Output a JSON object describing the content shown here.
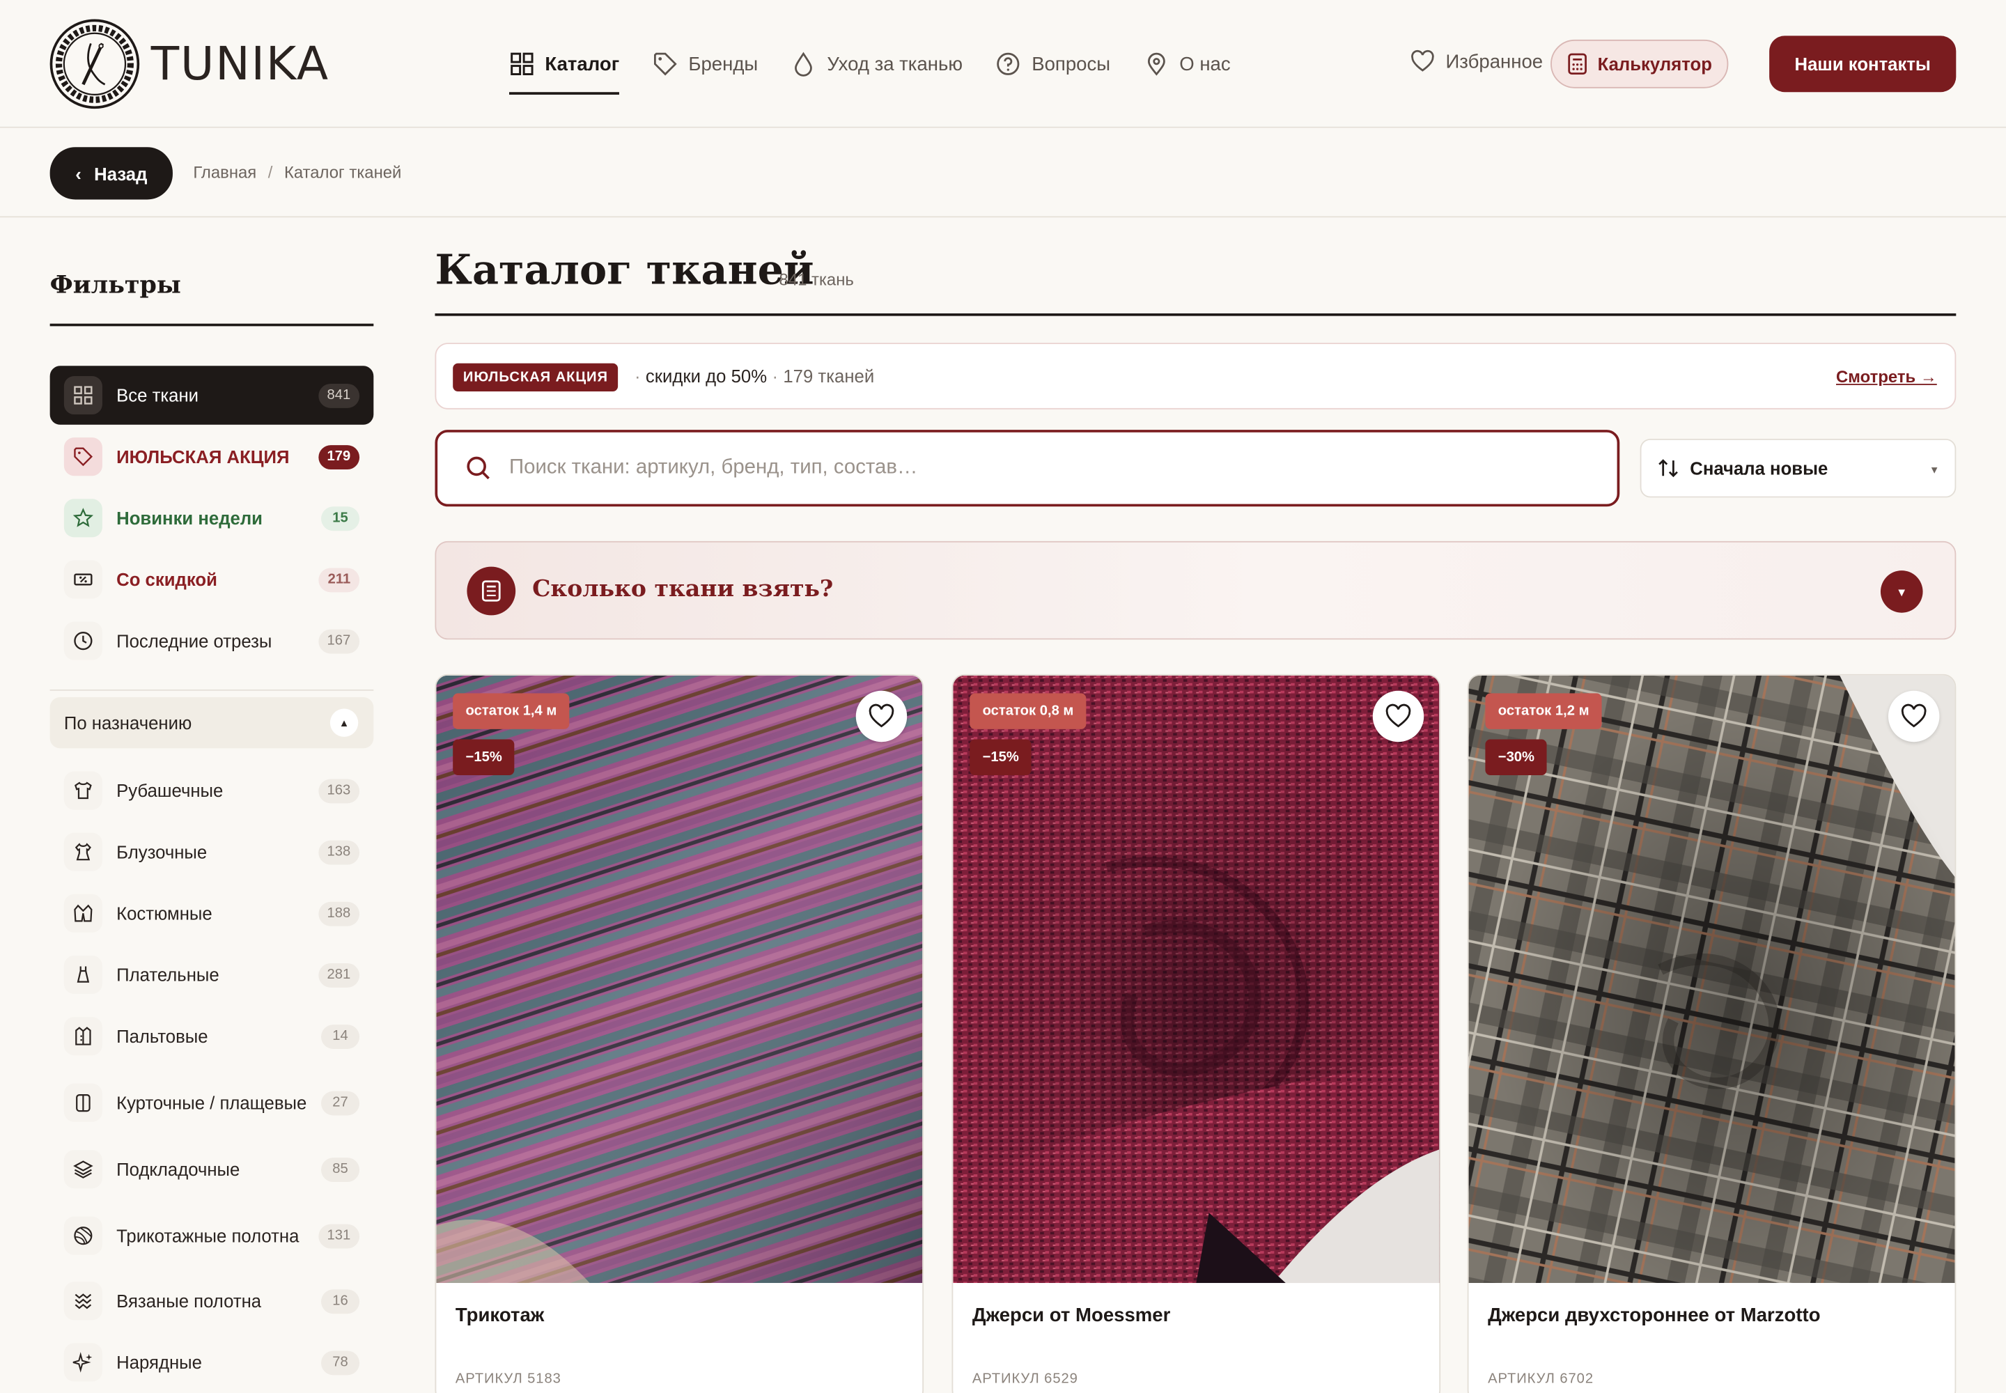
{
  "brand": {
    "name": "TUNIKA"
  },
  "nav": {
    "items": [
      {
        "label": "Каталог",
        "icon": "grid-icon",
        "active": true
      },
      {
        "label": "Бренды",
        "icon": "tag-icon"
      },
      {
        "label": "Уход за тканью",
        "icon": "drop-icon"
      },
      {
        "label": "Вопросы",
        "icon": "question-icon"
      },
      {
        "label": "О нас",
        "icon": "location-pin-icon"
      }
    ],
    "favorites": "Избранное",
    "calculator": "Калькулятор",
    "contacts": "Наши контакты"
  },
  "breadcrumb": {
    "back": "Назад",
    "items": [
      "Главная",
      "Каталог тканей"
    ],
    "separator": "/"
  },
  "sidebar": {
    "title": "Фильтры",
    "quick": [
      {
        "label": "Все ткани",
        "count": "841",
        "icon": "grid-icon"
      },
      {
        "label": "ИЮЛЬСКАЯ АКЦИЯ",
        "count": "179",
        "icon": "tag-icon"
      },
      {
        "label": "Новинки недели",
        "count": "15",
        "icon": "star-icon"
      },
      {
        "label": "Со скидкой",
        "count": "211",
        "icon": "discount-ticket-icon"
      },
      {
        "label": "Последние отрезы",
        "count": "167",
        "icon": "clock-icon"
      }
    ],
    "group": {
      "label": "По назначению",
      "toggle": "▲"
    },
    "purposes": [
      {
        "label": "Рубашечные",
        "count": "163",
        "icon": "shirt-icon"
      },
      {
        "label": "Блузочные",
        "count": "138",
        "icon": "blouse-icon"
      },
      {
        "label": "Костюмные",
        "count": "188",
        "icon": "suit-icon"
      },
      {
        "label": "Плательные",
        "count": "281",
        "icon": "dress-icon"
      },
      {
        "label": "Пальтовые",
        "count": "14",
        "icon": "coat-icon"
      },
      {
        "label": "Курточные / плащевые",
        "count": "27",
        "icon": "jacket-icon"
      },
      {
        "label": "Подкладочные",
        "count": "85",
        "icon": "layers-icon"
      },
      {
        "label": "Трикотажные полотна",
        "count": "131",
        "icon": "yarn-ball-icon"
      },
      {
        "label": "Вязаные полотна",
        "count": "16",
        "icon": "knit-icon"
      },
      {
        "label": "Нарядные",
        "count": "78",
        "icon": "sparkle-icon"
      }
    ]
  },
  "main": {
    "title": "Каталог тканей",
    "count": "841 ткань",
    "promo": {
      "tag": "ИЮЛЬСКАЯ АКЦИЯ",
      "text": "скидки до 50%",
      "extra": "179 тканей",
      "link": "Смотреть →"
    },
    "search": {
      "placeholder": "Поиск ткани: артикул, бренд, тип, состав…"
    },
    "sort": {
      "label": "Сначала новые"
    },
    "calculator_panel": {
      "title": "Сколько ткани взять?"
    }
  },
  "cards": [
    {
      "rest": "остаток 1,4 м",
      "discount": "−15%",
      "name": "Трикотаж",
      "sku": "АРТИКУЛ 5183"
    },
    {
      "rest": "остаток 0,8 м",
      "discount": "−15%",
      "name": "Джерси от Moessmer",
      "sku": "АРТИКУЛ 6529"
    },
    {
      "rest": "остаток 1,2 м",
      "discount": "−30%",
      "name": "Джерси двухстороннее от Marzotto",
      "sku": "АРТИКУЛ 6702"
    }
  ],
  "colors": {
    "accent": "#7a1c1f",
    "accent_light": "#c4564f",
    "green": "#2e6b3a",
    "background": "#faf8f4",
    "dark": "#1e1917"
  }
}
